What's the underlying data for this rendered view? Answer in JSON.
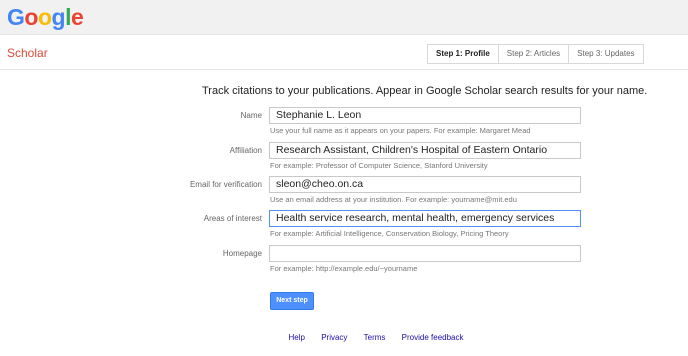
{
  "header": {
    "logo_letters": [
      "G",
      "o",
      "o",
      "g",
      "l",
      "e"
    ],
    "logo_alt": "Google"
  },
  "subheader": {
    "product": "Scholar",
    "steps": [
      {
        "label": "Step 1: Profile",
        "active": true
      },
      {
        "label": "Step 2: Articles",
        "active": false
      },
      {
        "label": "Step 3: Updates",
        "active": false
      }
    ]
  },
  "form": {
    "tagline": "Track citations to your publications. Appear in Google Scholar search results for your name.",
    "fields": {
      "name": {
        "label": "Name",
        "value": "Stephanie L. Leon",
        "hint": "Use your full name as it appears on your papers. For example: Margaret Mead"
      },
      "affiliation": {
        "label": "Affiliation",
        "value": "Research Assistant, Children's Hospital of Eastern Ontario",
        "hint": "For example: Professor of Computer Science, Stanford University"
      },
      "email": {
        "label": "Email for verification",
        "value": "sleon@cheo.on.ca",
        "hint": "Use an email address at your institution. For example: yourname@mit.edu"
      },
      "interests": {
        "label": "Areas of interest",
        "value": "Health service research, mental health, emergency services",
        "hint": "For example: Artificial Intelligence, Conservation Biology, Pricing Theory"
      },
      "homepage": {
        "label": "Homepage",
        "value": "",
        "hint": "For example: http://example.edu/~yourname"
      }
    },
    "next_label": "Next step"
  },
  "footer": {
    "links": [
      "Help",
      "Privacy",
      "Terms",
      "Provide feedback"
    ]
  },
  "colors": {
    "accent": "#4d90fe",
    "scholar_red": "#dd4b39",
    "link": "#1a0dab"
  }
}
